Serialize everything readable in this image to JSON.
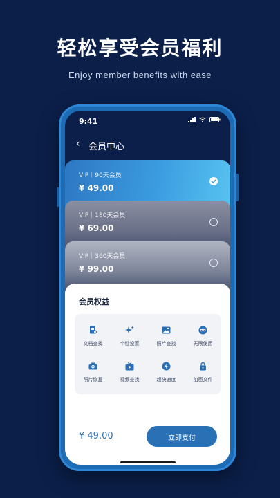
{
  "promo": {
    "title": "轻松享受会员福利",
    "subtitle": "Enjoy member benefits with ease"
  },
  "status_bar": {
    "time": "9:41",
    "icons": [
      "signal-icon",
      "wifi-icon",
      "battery-icon"
    ]
  },
  "nav": {
    "back_icon": "chevron-left-icon",
    "title": "会员中心"
  },
  "plans": [
    {
      "label": "VIP｜90天会员",
      "price": "¥ 49.00",
      "selected": true
    },
    {
      "label": "VIP｜180天会员",
      "price": "¥ 69.00",
      "selected": false
    },
    {
      "label": "VIP｜360天会员",
      "price": "¥ 99.00",
      "selected": false
    }
  ],
  "benefits": {
    "title": "会员权益",
    "items": [
      {
        "label": "文档查找",
        "icon": "document-search-icon"
      },
      {
        "label": "个性设置",
        "icon": "sparkle-icon"
      },
      {
        "label": "照片查找",
        "icon": "image-icon"
      },
      {
        "label": "无限使用",
        "icon": "infinity-icon"
      },
      {
        "label": "照片恢复",
        "icon": "camera-icon"
      },
      {
        "label": "视频查找",
        "icon": "video-icon"
      },
      {
        "label": "超快速度",
        "icon": "speed-icon"
      },
      {
        "label": "加密文件",
        "icon": "lock-icon"
      }
    ]
  },
  "footer": {
    "total": "¥ 49.00",
    "pay_label": "立即支付"
  },
  "colors": {
    "background": "#0b1f49",
    "accent": "#2a70b4",
    "icon": "#2a6fb6"
  }
}
